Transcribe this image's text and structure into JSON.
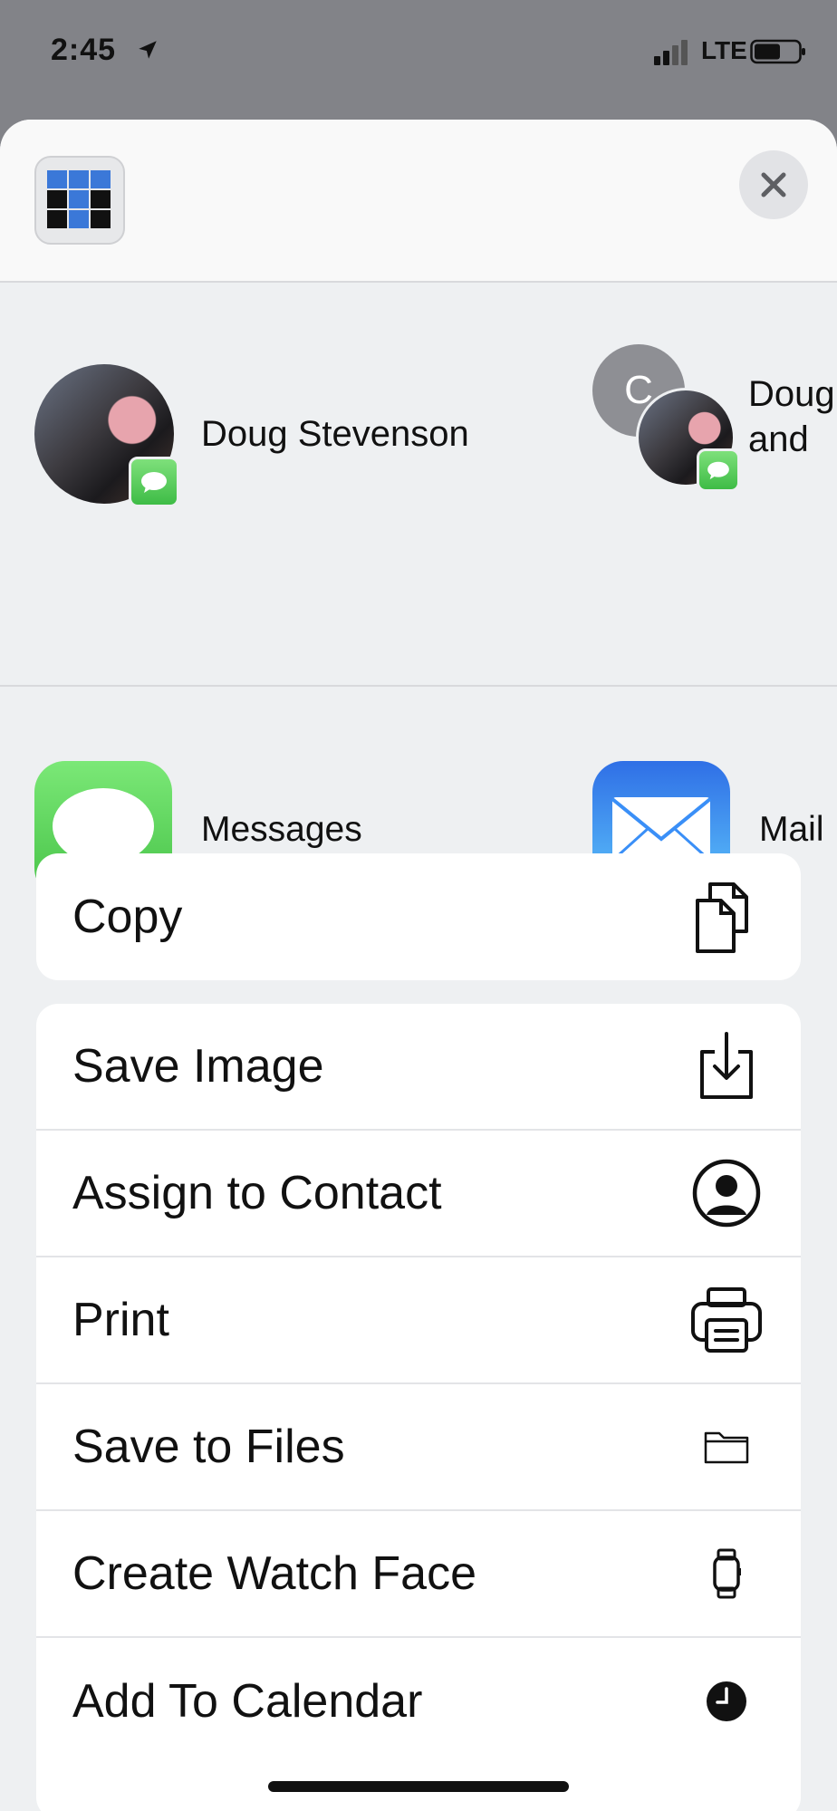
{
  "status_bar": {
    "time": "2:45",
    "network": "LTE"
  },
  "share_sheet": {
    "close_label": "×",
    "people": [
      {
        "name": "Doug Stevenson",
        "avatar": "photo",
        "badge": "messages-icon"
      },
      {
        "name": "Doug",
        "name_line2": "and",
        "avatar_initial": "C",
        "badge": "messages-icon"
      }
    ],
    "apps": [
      {
        "label": "Messages",
        "icon": "messages-app-icon",
        "color": "#5fd35a"
      },
      {
        "label": "Mail",
        "icon": "mail-app-icon",
        "color": "#3a8ff7"
      }
    ],
    "action_groups": [
      [
        {
          "label": "Copy",
          "icon": "copy-icon"
        }
      ],
      [
        {
          "label": "Save Image",
          "icon": "save-image-icon"
        },
        {
          "label": "Assign to Contact",
          "icon": "contact-icon"
        },
        {
          "label": "Print",
          "icon": "printer-icon"
        },
        {
          "label": "Save to Files",
          "icon": "folder-icon"
        },
        {
          "label": "Create Watch Face",
          "icon": "watch-icon"
        },
        {
          "label": "Add To Calendar",
          "icon": "clock-icon"
        }
      ]
    ]
  }
}
